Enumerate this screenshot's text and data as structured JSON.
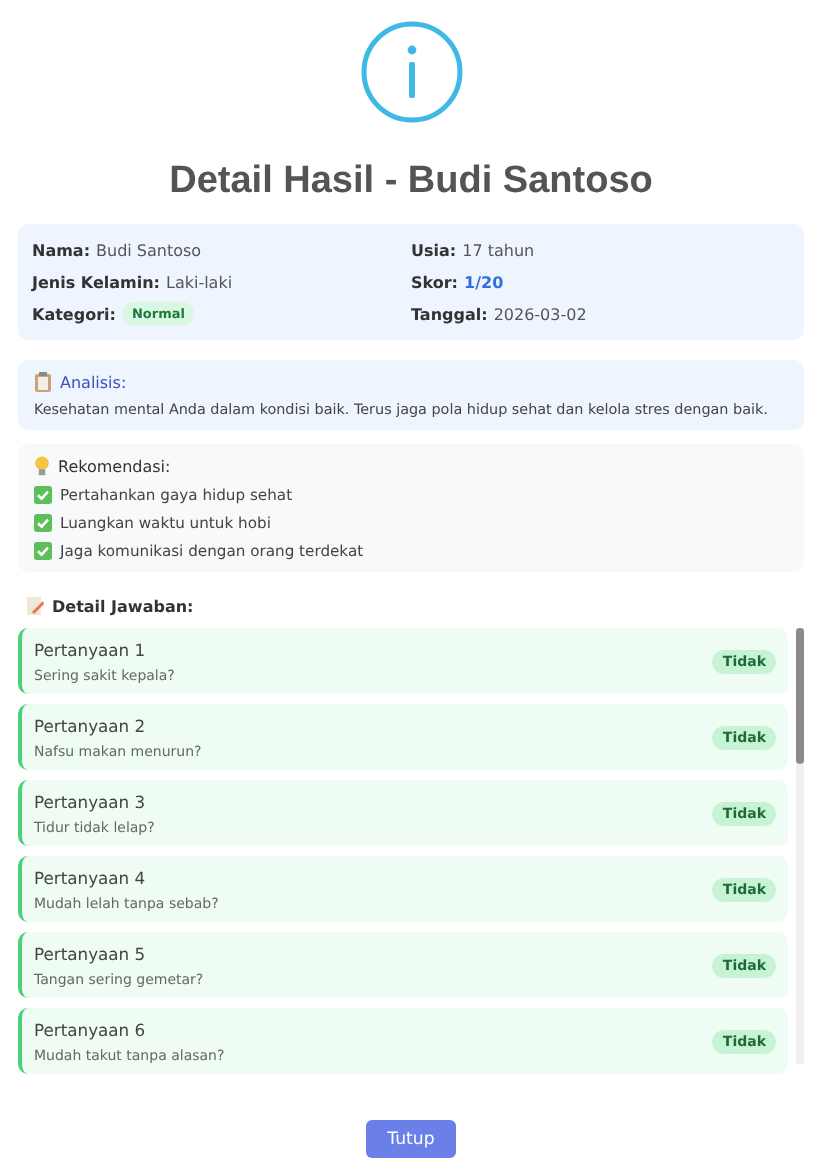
{
  "title": "Detail Hasil - Budi Santoso",
  "info": [
    {
      "label": "Nama:",
      "value": "Budi Santoso",
      "kind": "text"
    },
    {
      "label": "Usia:",
      "value": "17 tahun",
      "kind": "text"
    },
    {
      "label": "Jenis Kelamin:",
      "value": "Laki-laki",
      "kind": "text"
    },
    {
      "label": "Skor:",
      "value": "1/20",
      "kind": "score"
    },
    {
      "label": "Kategori:",
      "value": "Normal",
      "kind": "badge"
    },
    {
      "label": "Tanggal:",
      "value": "2026-03-02",
      "kind": "text"
    }
  ],
  "analysis": {
    "heading": "Analisis:",
    "text": "Kesehatan mental Anda dalam kondisi baik. Terus jaga pola hidup sehat dan kelola stres dengan baik."
  },
  "recommendations": {
    "heading": "Rekomendasi:",
    "items": [
      "Pertahankan gaya hidup sehat",
      "Luangkan waktu untuk hobi",
      "Jaga komunikasi dengan orang terdekat"
    ]
  },
  "answers_heading": "Detail Jawaban:",
  "answers": [
    {
      "question": "Pertanyaan 1",
      "text": "Sering sakit kepala?",
      "answer": "Tidak"
    },
    {
      "question": "Pertanyaan 2",
      "text": "Nafsu makan menurun?",
      "answer": "Tidak"
    },
    {
      "question": "Pertanyaan 3",
      "text": "Tidur tidak lelap?",
      "answer": "Tidak"
    },
    {
      "question": "Pertanyaan 4",
      "text": "Mudah lelah tanpa sebab?",
      "answer": "Tidak"
    },
    {
      "question": "Pertanyaan 5",
      "text": "Tangan sering gemetar?",
      "answer": "Tidak"
    },
    {
      "question": "Pertanyaan 6",
      "text": "Mudah takut tanpa alasan?",
      "answer": "Tidak"
    }
  ],
  "close_button": "Tutup"
}
